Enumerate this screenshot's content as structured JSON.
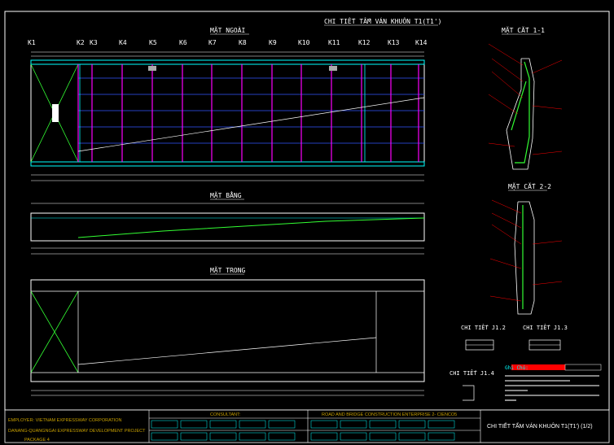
{
  "colors": {
    "background": "#000000",
    "frame": "#ffffff",
    "title_text": "#ffffff",
    "dimension": "#ffffff",
    "rebar_cyan": "#00ffff",
    "rebar_magenta": "#ff00ff",
    "rebar_blue": "#3355ff",
    "rebar_green": "#33ff33",
    "rebar_yellow": "#ffff00",
    "accent_red": "#ff0000",
    "titleblock_text": "#c8a000"
  },
  "header": {
    "sheet_title": "CHI TIẾT TẤM VÁN KHUÔN T1(T1')"
  },
  "views": {
    "mat_ngoai": "MẶT NGOÀI",
    "mat_bang": "MẶT BẰNG",
    "mat_trong": "MẶT TRONG",
    "mat_cat_11": "MẶT CẮT 1-1",
    "mat_cat_22": "MẶT CẮT 2-2",
    "chi_tiet_j12a": "CHI TIẾT J1.2",
    "chi_tiet_j13": "CHI TIẾT J1.3",
    "chi_tiet_j14": "CHI TIẾT J1.4",
    "ghi_chu": "Ghi Chú:"
  },
  "section_marks": [
    "K1",
    "K2",
    "K3",
    "K4",
    "K5",
    "K6",
    "K7",
    "K8",
    "K9",
    "K10",
    "K11",
    "K12",
    "K13",
    "K14"
  ],
  "titleblock": {
    "employer": "EMPLOYER:  VIETNAM EXPRESSWAY CORPORATION",
    "project": "DANANG-QUANGNGAI EXPRESSWAY DEVELOPMENT PROJECT",
    "package": "PACKAGE 4",
    "consultant": "CONSULTANT:",
    "contractor": "ROAD AND BRIDGE CONSTRUCTION ENTERPRISE 2- CIENCO5",
    "drawing_title": "CHI TIẾT TẤM VÁN KHUÔN T1(T1') (1/2)"
  }
}
